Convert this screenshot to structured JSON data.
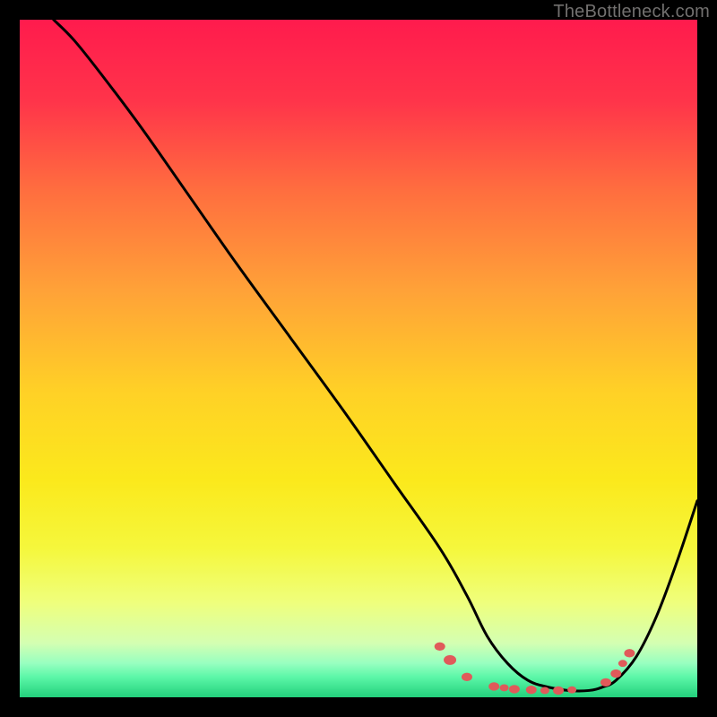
{
  "watermark": "TheBottleneck.com",
  "chart_data": {
    "type": "line",
    "title": "",
    "xlabel": "",
    "ylabel": "",
    "xlim": [
      0,
      100
    ],
    "ylim": [
      0,
      100
    ],
    "gradient_stops": [
      {
        "pct": 0,
        "color": "#ff1b4d"
      },
      {
        "pct": 12,
        "color": "#ff344a"
      },
      {
        "pct": 25,
        "color": "#ff6d3f"
      },
      {
        "pct": 40,
        "color": "#ffa238"
      },
      {
        "pct": 55,
        "color": "#ffd126"
      },
      {
        "pct": 68,
        "color": "#fbe91c"
      },
      {
        "pct": 78,
        "color": "#f5f73c"
      },
      {
        "pct": 86,
        "color": "#efff7c"
      },
      {
        "pct": 92,
        "color": "#d4ffb2"
      },
      {
        "pct": 95,
        "color": "#97ffc0"
      },
      {
        "pct": 97,
        "color": "#5cf7a8"
      },
      {
        "pct": 100,
        "color": "#23d07c"
      }
    ],
    "series": [
      {
        "name": "bottleneck-curve",
        "x": [
          5,
          8,
          12,
          18,
          25,
          32,
          40,
          48,
          55,
          62,
          66,
          69,
          72,
          75,
          78,
          81,
          84,
          86,
          88,
          91,
          94,
          97,
          100
        ],
        "y": [
          100,
          97,
          92,
          84,
          74,
          64,
          53,
          42,
          32,
          22,
          15,
          9,
          5,
          2.5,
          1.5,
          1,
          1,
          1.5,
          2.5,
          6,
          12,
          20,
          29
        ]
      }
    ],
    "markers": {
      "name": "highlight-dots",
      "color": "#e05a5a",
      "points": [
        {
          "x": 62,
          "y": 7.5,
          "r": 6
        },
        {
          "x": 63.5,
          "y": 5.5,
          "r": 7
        },
        {
          "x": 66,
          "y": 3.0,
          "r": 6
        },
        {
          "x": 70,
          "y": 1.6,
          "r": 6
        },
        {
          "x": 71.5,
          "y": 1.4,
          "r": 5
        },
        {
          "x": 73,
          "y": 1.2,
          "r": 6
        },
        {
          "x": 75.5,
          "y": 1.1,
          "r": 6
        },
        {
          "x": 77.5,
          "y": 1.0,
          "r": 5
        },
        {
          "x": 79.5,
          "y": 1.0,
          "r": 6
        },
        {
          "x": 81.5,
          "y": 1.1,
          "r": 5
        },
        {
          "x": 86.5,
          "y": 2.2,
          "r": 6
        },
        {
          "x": 88,
          "y": 3.5,
          "r": 6
        },
        {
          "x": 89,
          "y": 5.0,
          "r": 5
        },
        {
          "x": 90,
          "y": 6.5,
          "r": 6
        }
      ]
    }
  }
}
